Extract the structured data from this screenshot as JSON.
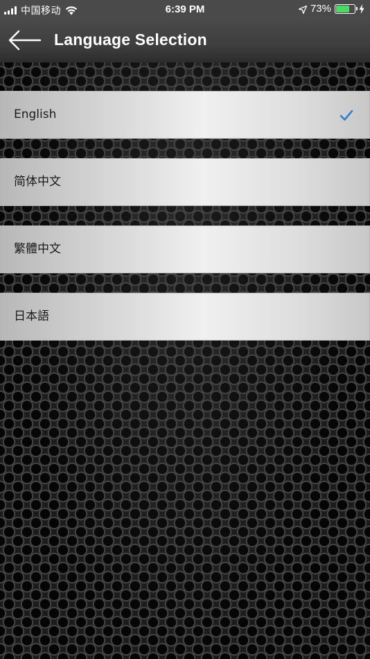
{
  "status_bar": {
    "carrier": "中国移动",
    "time": "6:39 PM",
    "battery_percent": "73%",
    "battery_level": 0.73,
    "icons": [
      "signal-icon",
      "wifi-icon",
      "location-arrow-icon",
      "battery-icon",
      "charging-bolt-icon"
    ]
  },
  "nav": {
    "back_icon": "arrow-left-icon",
    "title": "Language Selection"
  },
  "languages": [
    {
      "label": "English",
      "selected": true
    },
    {
      "label": "简体中文",
      "selected": false
    },
    {
      "label": "繁體中文",
      "selected": false
    },
    {
      "label": "日本語",
      "selected": false
    }
  ],
  "colors": {
    "accent_check": "#2f7fd1",
    "battery_fill": "#4cd964",
    "nav_background": "#3e3e3e"
  }
}
